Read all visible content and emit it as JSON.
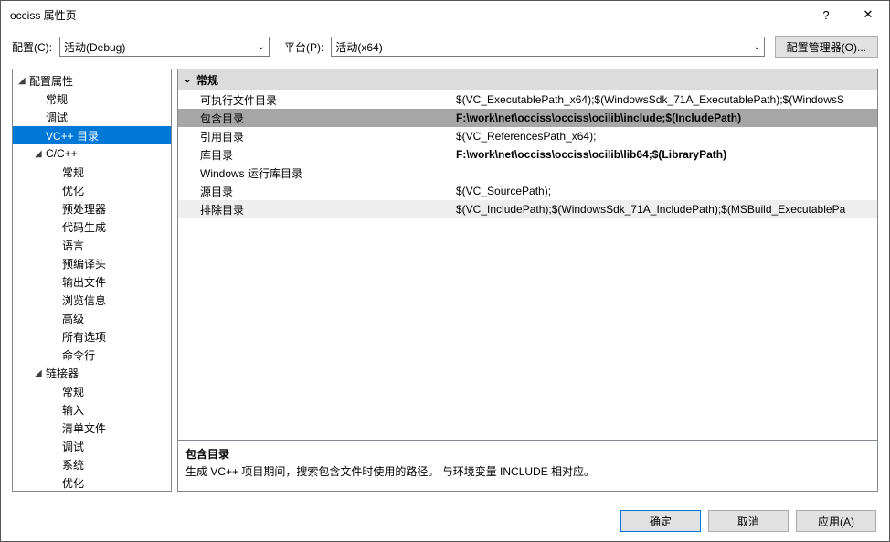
{
  "title": "occiss 属性页",
  "help_glyph": "?",
  "close_glyph": "✕",
  "toolbar": {
    "config_label": "配置(C):",
    "config_value": "活动(Debug)",
    "platform_label": "平台(P):",
    "platform_value": "活动(x64)",
    "cfgmgr_label": "配置管理器(O)..."
  },
  "tree": [
    {
      "label": "配置属性",
      "depth": 0,
      "exp": "◢"
    },
    {
      "label": "常规",
      "depth": 1
    },
    {
      "label": "调试",
      "depth": 1
    },
    {
      "label": "VC++ 目录",
      "depth": 1,
      "selected": true
    },
    {
      "label": "C/C++",
      "depth": 1,
      "exp": "◢"
    },
    {
      "label": "常规",
      "depth": 2
    },
    {
      "label": "优化",
      "depth": 2
    },
    {
      "label": "预处理器",
      "depth": 2
    },
    {
      "label": "代码生成",
      "depth": 2
    },
    {
      "label": "语言",
      "depth": 2
    },
    {
      "label": "预编译头",
      "depth": 2
    },
    {
      "label": "输出文件",
      "depth": 2
    },
    {
      "label": "浏览信息",
      "depth": 2
    },
    {
      "label": "高级",
      "depth": 2
    },
    {
      "label": "所有选项",
      "depth": 2
    },
    {
      "label": "命令行",
      "depth": 2
    },
    {
      "label": "链接器",
      "depth": 1,
      "exp": "◢"
    },
    {
      "label": "常规",
      "depth": 2
    },
    {
      "label": "输入",
      "depth": 2
    },
    {
      "label": "清单文件",
      "depth": 2
    },
    {
      "label": "调试",
      "depth": 2
    },
    {
      "label": "系统",
      "depth": 2
    },
    {
      "label": "优化",
      "depth": 2
    }
  ],
  "grid": {
    "category": "常规",
    "rows": [
      {
        "k": "可执行文件目录",
        "v": "$(VC_ExecutablePath_x64);$(WindowsSdk_71A_ExecutablePath);$(WindowsS"
      },
      {
        "k": "包含目录",
        "v": "F:\\work\\net\\occiss\\occiss\\ocilib\\include;$(IncludePath)",
        "bold": true,
        "sel": true
      },
      {
        "k": "引用目录",
        "v": "$(VC_ReferencesPath_x64);"
      },
      {
        "k": "库目录",
        "v": "F:\\work\\net\\occiss\\occiss\\ocilib\\lib64;$(LibraryPath)",
        "bold": true
      },
      {
        "k": "Windows 运行库目录",
        "v": ""
      },
      {
        "k": "源目录",
        "v": "$(VC_SourcePath);"
      },
      {
        "k": "排除目录",
        "v": "$(VC_IncludePath);$(WindowsSdk_71A_IncludePath);$(MSBuild_ExecutablePa",
        "last": true
      }
    ]
  },
  "desc": {
    "title": "包含目录",
    "text": "生成 VC++ 项目期间，搜索包含文件时使用的路径。   与环境变量 INCLUDE 相对应。"
  },
  "footer": {
    "ok": "确定",
    "cancel": "取消",
    "apply": "应用(A)"
  }
}
